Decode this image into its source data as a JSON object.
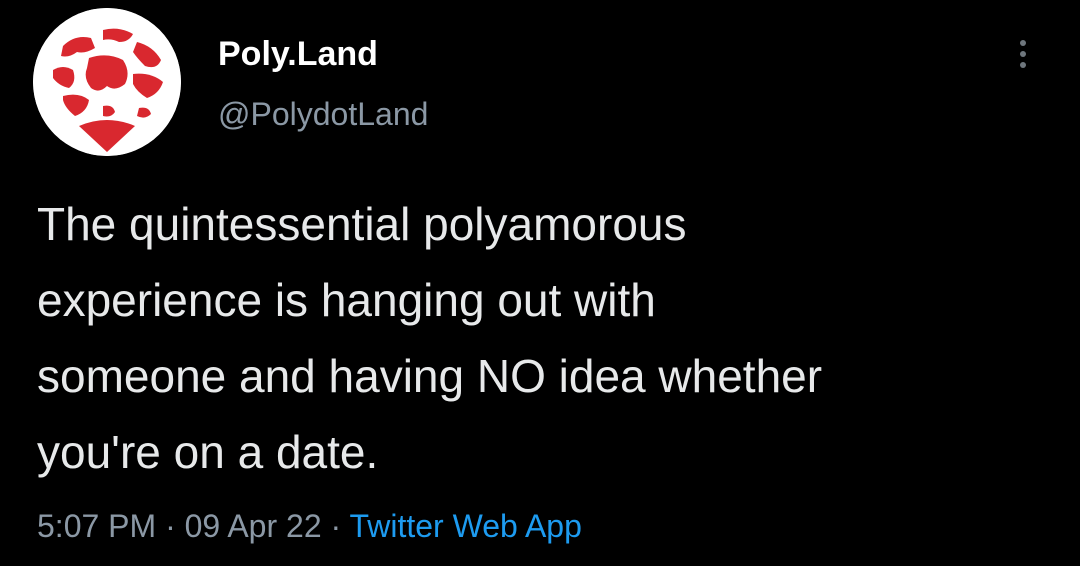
{
  "author": {
    "display_name": "Poly.Land",
    "handle": "@PolydotLand",
    "avatar_icon": "red-globe-heart-logo"
  },
  "tweet": {
    "lines": [
      "The quintessential polyamorous",
      "experience is hanging out with",
      "someone and having NO idea whether",
      "you're on a date."
    ]
  },
  "meta": {
    "time": "5:07 PM",
    "separator_1": " · ",
    "date": "09 Apr 22",
    "separator_2": " · ",
    "source": "Twitter Web App"
  },
  "icons": {
    "more": "more-vertical-icon"
  },
  "colors": {
    "background": "#000000",
    "text_primary": "#e7e9ea",
    "text_secondary": "#8b98a5",
    "link": "#1d9bf0",
    "logo_red": "#d9282f"
  }
}
